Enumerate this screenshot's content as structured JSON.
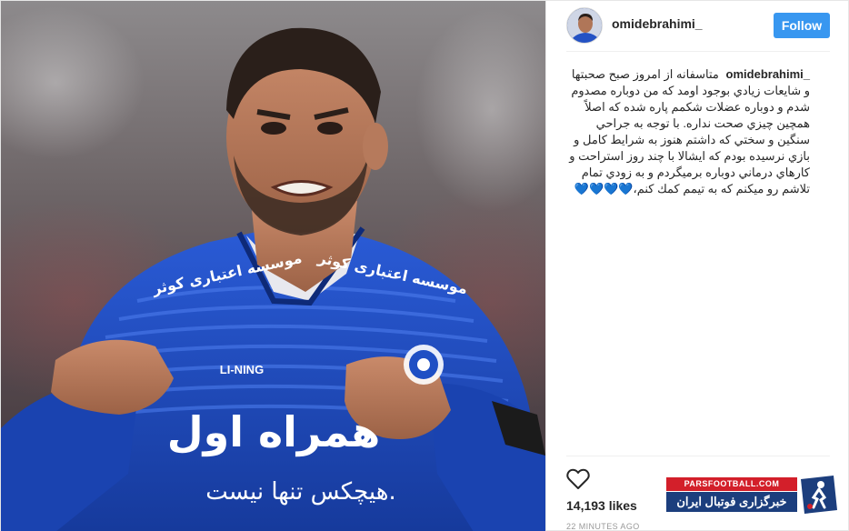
{
  "post": {
    "username": "omidebrahimi_",
    "follow_label": "Follow",
    "caption_user": "omidebrahimi_",
    "caption_text": "متاسفانه از امروز صبح صحبتها و شايعات زيادي بوجود اومد که من دوباره مصدوم شدم و دوباره عضلات شكمم پاره شده كه اصلاً همچين چيزي صحت نداره. با توجه به جراحي سنگين و سختي كه داشتم هنوز به شرايط كامل و بازي نرسيده بودم كه ايشالا با چند روز استراحت و كارهاي درماني دوباره برميگردم و به زودي تمام تلاشم رو ميكنم كه به تيمم كمك كنم،💙💙💙💙",
    "likes": "14,193 likes",
    "time": "22 MINUTES AGO"
  },
  "photo": {
    "jersey_sponsor_shoulder": "موسسه اعتباری کوثر",
    "jersey_sponsor_main": "همراه اول",
    "jersey_slogan": "هیچکس تنها نیست.",
    "jersey_brand": "LI-NING",
    "colors": {
      "jersey": "#1f4fc4",
      "jersey_dark": "#123288",
      "skin": "#b07658",
      "hair": "#2a1f1a"
    }
  },
  "watermark": {
    "site": "PARSFOOTBALL.COM",
    "title": "خبرگزاری فوتبال ایران"
  },
  "colors": {
    "follow": "#3897f0",
    "watermark_red": "#d31f2a",
    "watermark_blue": "#1c3e7d"
  }
}
